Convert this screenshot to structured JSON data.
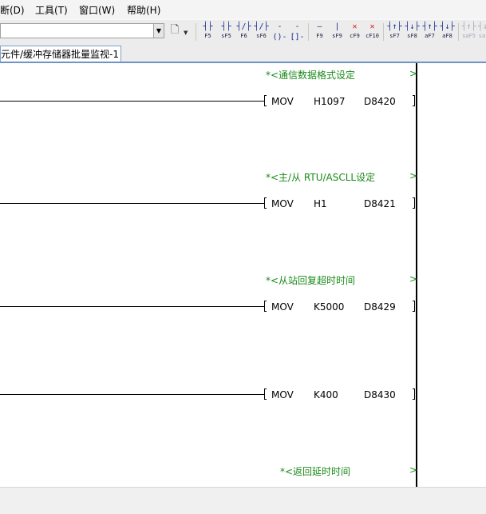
{
  "menu": {
    "items": [
      {
        "label": "断(D)"
      },
      {
        "label": "工具(T)"
      },
      {
        "label": "窗口(W)"
      },
      {
        "label": "帮助(H)"
      }
    ]
  },
  "toolbar": {
    "combo_value": "",
    "ladder_buttons": [
      {
        "symbol": "┤├",
        "key": "F5"
      },
      {
        "symbol": "┤├",
        "key": "sF5"
      },
      {
        "symbol": "┤/├",
        "key": "F6"
      },
      {
        "symbol": "┤/├",
        "key": "sF6"
      },
      {
        "symbol": "-()-",
        "key": "F7"
      },
      {
        "symbol": "-[]-",
        "key": "F8"
      },
      {
        "symbol": "—",
        "key": "F9"
      },
      {
        "symbol": "|",
        "key": "sF9"
      },
      {
        "symbol": "✕",
        "key": "cF9"
      },
      {
        "symbol": "✕",
        "key": "cF10"
      },
      {
        "symbol": "┤↑├",
        "key": "sF7"
      },
      {
        "symbol": "┤↓├",
        "key": "sF8"
      },
      {
        "symbol": "┤↑├",
        "key": "aF7"
      },
      {
        "symbol": "┤↓├",
        "key": "aF8"
      },
      {
        "symbol": "┤↑├",
        "key": "saF5"
      },
      {
        "symbol": "┤↓├",
        "key": "sa"
      }
    ]
  },
  "tab": {
    "label": "元件/缓冲存储器批量监视-1"
  },
  "ladder": {
    "rungs": [
      {
        "comment": "*<通信数据格式设定",
        "comment_end": ">",
        "instruction": "MOV",
        "operand1": "H1097",
        "operand2": "D8420"
      },
      {
        "comment": "*<主/从 RTU/ASCLL设定",
        "comment_end": ">",
        "instruction": "MOV",
        "operand1": "H1",
        "operand2": "D8421"
      },
      {
        "comment": "*<从站回复超时时间",
        "comment_end": ">",
        "instruction": "MOV",
        "operand1": "K5000",
        "operand2": "D8429"
      },
      {
        "comment": "",
        "comment_end": "",
        "instruction": "MOV",
        "operand1": "K400",
        "operand2": "D8430"
      },
      {
        "comment": "*<返回延时时间",
        "comment_end": ">"
      }
    ]
  },
  "colors": {
    "comment_text": "#1a8a1a",
    "tab_border": "#7da2ce",
    "ladder_icon": "#1a2a8c",
    "delete_icon": "#e01818"
  }
}
